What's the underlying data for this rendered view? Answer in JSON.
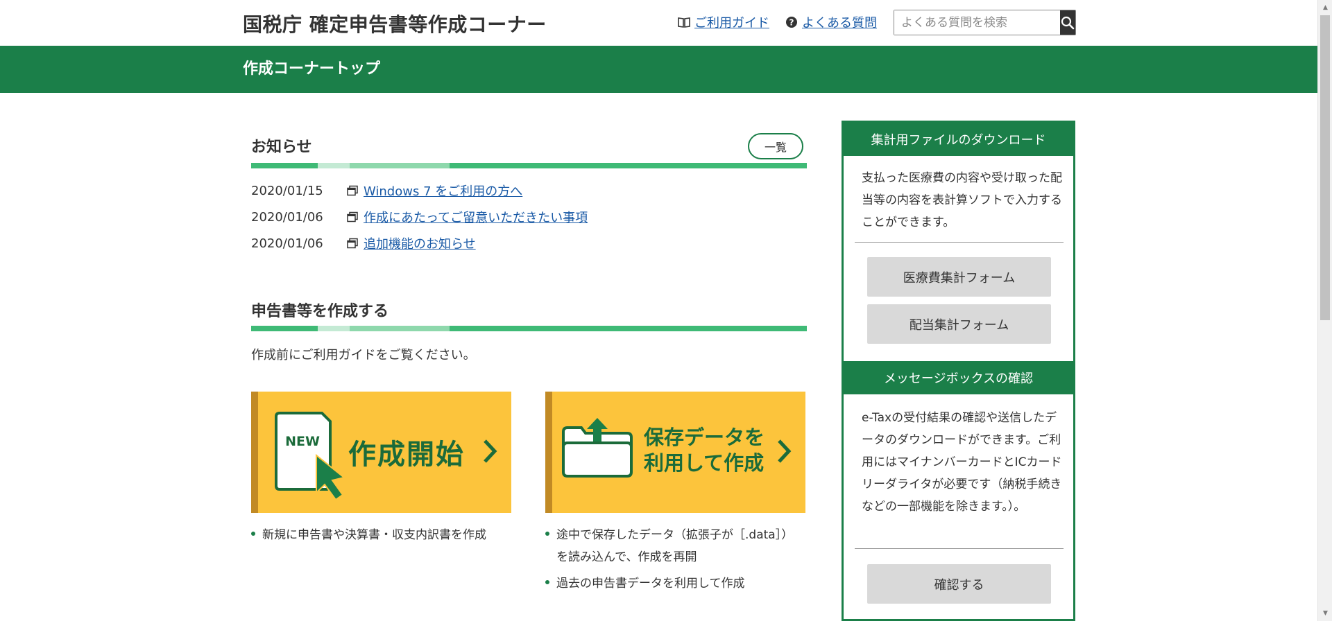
{
  "header": {
    "site_title": "国税庁 確定申告書等作成コーナー",
    "guide_link": "ご利用ガイド",
    "faq_link": "よくある質問",
    "search_placeholder": "よくある質問を検索"
  },
  "band": {
    "title": "作成コーナートップ"
  },
  "news": {
    "heading": "お知らせ",
    "list_button": "一覧",
    "items": [
      {
        "date": "2020/01/15",
        "title": "Windows 7 をご利用の方へ"
      },
      {
        "date": "2020/01/06",
        "title": "作成にあたってご留意いただきたい事項"
      },
      {
        "date": "2020/01/06",
        "title": "追加機能のお知らせ"
      }
    ]
  },
  "create": {
    "heading": "申告書等を作成する",
    "intro": "作成前にご利用ガイドをご覧ください。",
    "new_card": {
      "badge": "NEW",
      "label": "作成開始",
      "bullets": [
        "新規に申告書や決算書・収支内訳書を作成"
      ]
    },
    "saved_card": {
      "label_line1": "保存データを",
      "label_line2": "利用して作成",
      "bullet1_line1": "途中で保存したデータ（拡張子が［.data］）",
      "bullet1_line2": "を読み込んで、作成を再開",
      "bullet2": "過去の申告書データを利用して作成"
    }
  },
  "sidebar": {
    "download": {
      "heading": "集計用ファイルのダウンロード",
      "text": "支払った医療費の内容や受け取った配当等の内容を表計算ソフトで入力することができます。",
      "medical_button": "医療費集計フォーム",
      "dividend_button": "配当集計フォーム"
    },
    "messagebox": {
      "heading": "メッセージボックスの確認",
      "text": "e-Taxの受付結果の確認や送信したデータのダウンロードができます。ご利用にはマイナンバーカードとICカードリーダライタが必要です（納税手続きなどの一部機能を除きます。）。",
      "confirm_button": "確認する"
    }
  },
  "colors": {
    "brand_green": "#1b7f49",
    "card_yellow": "#fcc43c",
    "link_blue": "#1a5aa6"
  }
}
